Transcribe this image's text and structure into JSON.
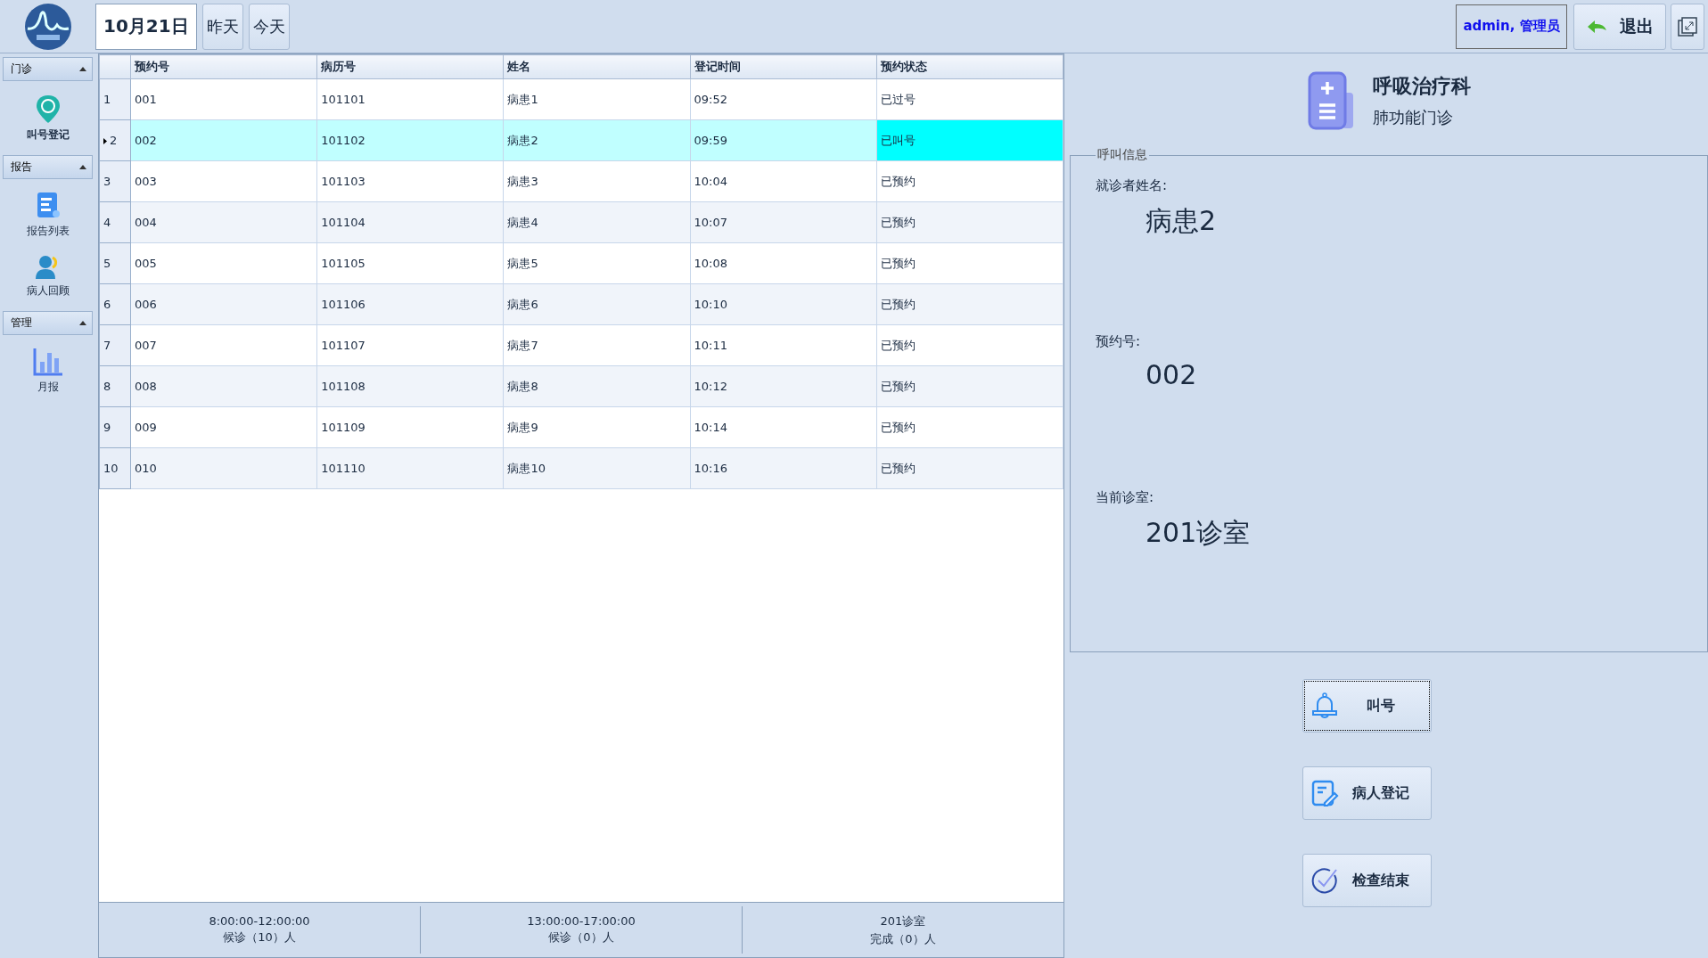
{
  "topbar": {
    "date": "10月21日",
    "day_buttons": [
      "昨天",
      "今天"
    ],
    "user": "admin, 管理员",
    "logout": "退出"
  },
  "sidebar": {
    "sections": [
      {
        "title": "门诊",
        "expanded": true,
        "items": [
          {
            "label": "叫号登记",
            "selected": true
          }
        ]
      },
      {
        "title": "报告",
        "expanded": true,
        "items": [
          {
            "label": "报告列表",
            "selected": false
          },
          {
            "label": "病人回顾",
            "selected": false
          }
        ]
      },
      {
        "title": "管理",
        "expanded": true,
        "items": [
          {
            "label": "月报",
            "selected": false
          }
        ]
      }
    ]
  },
  "table": {
    "columns": [
      "预约号",
      "病历号",
      "姓名",
      "登记时间",
      "预约状态"
    ],
    "rows": [
      {
        "index": "1",
        "cells": [
          "001",
          "101101",
          "病患1",
          "09:52",
          "已过号"
        ],
        "selected": false,
        "called": false
      },
      {
        "index": "2",
        "cells": [
          "002",
          "101102",
          "病患2",
          "09:59",
          "已叫号"
        ],
        "selected": true,
        "called": true
      },
      {
        "index": "3",
        "cells": [
          "003",
          "101103",
          "病患3",
          "10:04",
          "已预约"
        ],
        "selected": false,
        "called": false
      },
      {
        "index": "4",
        "cells": [
          "004",
          "101104",
          "病患4",
          "10:07",
          "已预约"
        ],
        "selected": false,
        "called": false
      },
      {
        "index": "5",
        "cells": [
          "005",
          "101105",
          "病患5",
          "10:08",
          "已预约"
        ],
        "selected": false,
        "called": false
      },
      {
        "index": "6",
        "cells": [
          "006",
          "101106",
          "病患6",
          "10:10",
          "已预约"
        ],
        "selected": false,
        "called": false
      },
      {
        "index": "7",
        "cells": [
          "007",
          "101107",
          "病患7",
          "10:11",
          "已预约"
        ],
        "selected": false,
        "called": false
      },
      {
        "index": "8",
        "cells": [
          "008",
          "101108",
          "病患8",
          "10:12",
          "已预约"
        ],
        "selected": false,
        "called": false
      },
      {
        "index": "9",
        "cells": [
          "009",
          "101109",
          "病患9",
          "10:14",
          "已预约"
        ],
        "selected": false,
        "called": false
      },
      {
        "index": "10",
        "cells": [
          "010",
          "101110",
          "病患10",
          "10:16",
          "已预约"
        ],
        "selected": false,
        "called": false
      }
    ]
  },
  "status_bar": [
    {
      "line1": "8:00:00-12:00:00",
      "line2": "候诊（10）人"
    },
    {
      "line1": "13:00:00-17:00:00",
      "line2": "候诊（0）人"
    },
    {
      "line1": "201诊室",
      "line2": "完成（0）人"
    }
  ],
  "department": {
    "title": "呼吸治疗科",
    "subtitle": "肺功能门诊"
  },
  "call_info": {
    "legend": "呼叫信息",
    "fields": [
      {
        "label": "就诊者姓名:",
        "value": "病患2"
      },
      {
        "label": "预约号:",
        "value": "002"
      },
      {
        "label": "当前诊室:",
        "value": "201诊室"
      }
    ]
  },
  "actions": [
    {
      "kind": "bell",
      "label": "叫号",
      "focused": true
    },
    {
      "kind": "form",
      "label": "病人登记",
      "focused": false
    },
    {
      "kind": "check",
      "label": "检查结束",
      "focused": false
    }
  ]
}
